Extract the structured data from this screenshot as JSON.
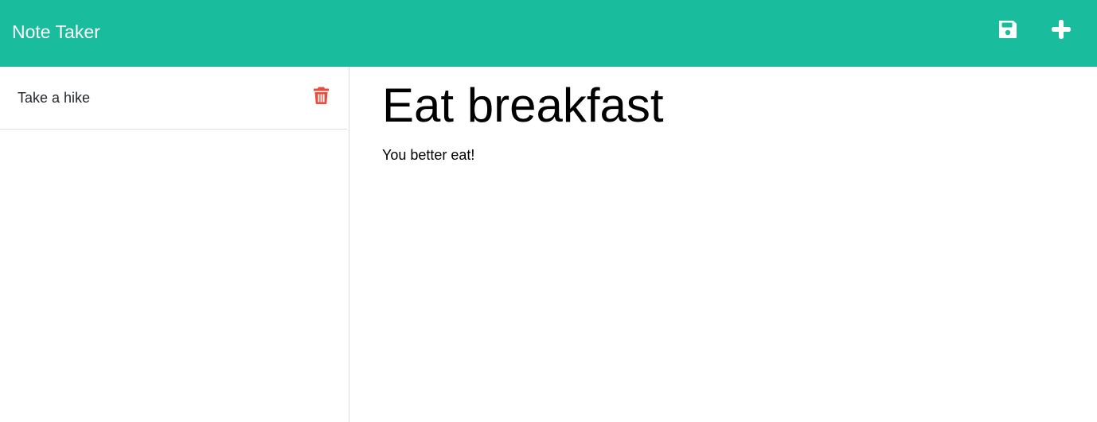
{
  "navbar": {
    "brand": "Note Taker",
    "save_icon": "save-icon",
    "new_icon": "plus-icon",
    "background_color": "#19bc9c"
  },
  "sidebar": {
    "notes": [
      {
        "title": "Take a hike",
        "delete_icon": "trash-icon"
      }
    ]
  },
  "editor": {
    "title": "Eat breakfast",
    "text": "You better eat!"
  },
  "colors": {
    "accent": "#19bc9c",
    "delete": "#e74c3c"
  }
}
